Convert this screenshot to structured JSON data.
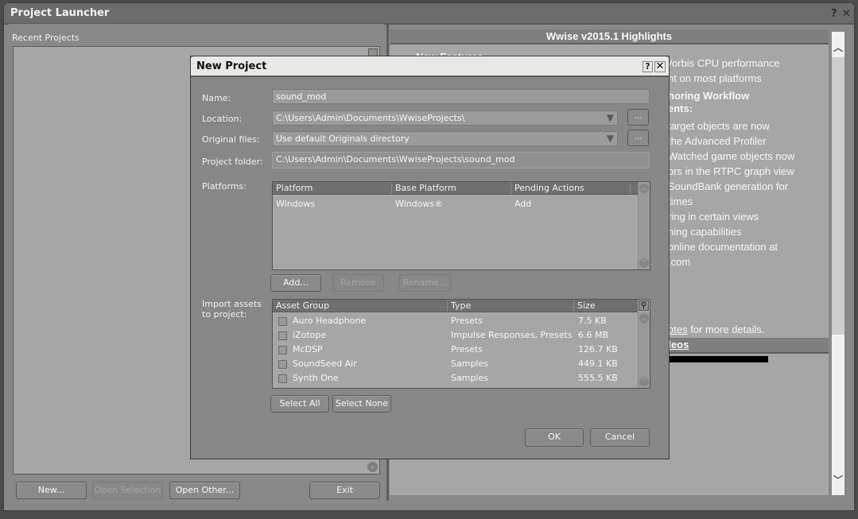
{
  "launcher": {
    "title": "Project Launcher",
    "help_icon": "?",
    "close_icon": "✕",
    "recent_projects_label": "Recent Projects",
    "buttons": {
      "new": "New...",
      "open_selection": "Open Selection",
      "open_other": "Open Other...",
      "exit": "Exit"
    }
  },
  "highlights": {
    "header": "Wwise v2015.1 Highlights",
    "lines": [
      "New Features",
      "Vorbis CPU performance",
      "nt on most platforms",
      "horing Workflow",
      "ents:",
      "target objects are now",
      "the Advanced Profiler",
      "Watched game objects now",
      "ors in the RTPC graph view",
      "SoundBank generation for",
      "times",
      "ring in certain views",
      "ning capabilities",
      "online documentation at",
      ".com"
    ],
    "notes_link": "otes",
    "notes_suffix": " for more details.",
    "videos_header": "deos"
  },
  "dialog": {
    "title": "New Project",
    "help_icon": "?",
    "close_icon": "✕",
    "name_label": "Name:",
    "name_value": "sound_mod",
    "location_label": "Location:",
    "location_value": "C:\\Users\\Admin\\Documents\\WwiseProjects\\",
    "original_files_label": "Original files:",
    "original_files_value": "Use default Originals directory",
    "project_folder_label": "Project folder:",
    "project_folder_value": "C:\\Users\\Admin\\Documents\\WwiseProjects\\sound_mod",
    "browse_label": "...",
    "platforms_label": "Platforms:",
    "platform_columns": [
      "Platform",
      "Base Platform",
      "Pending Actions"
    ],
    "platform_rows": [
      {
        "platform": "Windows",
        "base": "Windows®",
        "pending": "Add"
      }
    ],
    "platform_buttons": {
      "add": "Add...",
      "remove": "Remove",
      "rename": "Rename..."
    },
    "import_label": "Import assets to project:",
    "asset_columns": [
      "Asset Group",
      "Type",
      "Size"
    ],
    "assets": [
      {
        "group": "Auro Headphone",
        "type": "Presets",
        "size": "7.5 KB",
        "checked": false
      },
      {
        "group": "iZotope",
        "type": "Impulse Responses, Presets",
        "size": "6.6 MB",
        "checked": false
      },
      {
        "group": "McDSP",
        "type": "Presets",
        "size": "126.7 KB",
        "checked": false
      },
      {
        "group": "SoundSeed Air",
        "type": "Samples",
        "size": "449.1 KB",
        "checked": false
      },
      {
        "group": "Synth One",
        "type": "Samples",
        "size": "555.5 KB",
        "checked": false
      }
    ],
    "select_all": "Select All",
    "select_none": "Select None",
    "ok": "OK",
    "cancel": "Cancel"
  }
}
